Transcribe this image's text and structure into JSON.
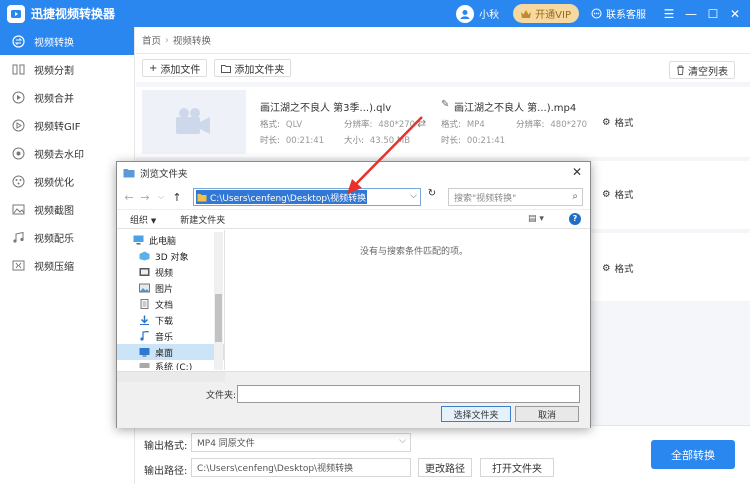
{
  "app": {
    "title": "迅捷视频转换器",
    "username": "小秋",
    "vip_label": "开通VIP",
    "support_label": "联系客服"
  },
  "colors": {
    "brand_blue": "#2b87f0",
    "vip_gold": "#f5d9a0",
    "annotation_red": "#e8312a"
  },
  "sidebar": {
    "items": [
      {
        "label": "视频转换",
        "icon": "convert-icon",
        "active": true
      },
      {
        "label": "视频分割",
        "icon": "split-icon"
      },
      {
        "label": "视频合并",
        "icon": "merge-icon"
      },
      {
        "label": "视频转GIF",
        "icon": "gif-icon"
      },
      {
        "label": "视频去水印",
        "icon": "watermark-icon"
      },
      {
        "label": "视频优化",
        "icon": "optimize-icon"
      },
      {
        "label": "视频截图",
        "icon": "screenshot-icon"
      },
      {
        "label": "视频配乐",
        "icon": "music-icon"
      },
      {
        "label": "视频压缩",
        "icon": "compress-icon"
      }
    ]
  },
  "breadcrumb": {
    "home": "首页",
    "current": "视频转换"
  },
  "toolbar": {
    "add_file": "添加文件",
    "add_folder": "添加文件夹",
    "clear_list": "清空列表"
  },
  "file": {
    "source_name": "画江湖之不良人 第3季...).qlv",
    "target_name": "画江湖之不良人 第...).mp4",
    "src_format_label": "格式:",
    "src_format": "QLV",
    "src_res_label": "分辨率:",
    "src_res": "480*270",
    "src_duration_label": "时长:",
    "src_duration": "00:21:41",
    "src_size_label": "大小:",
    "src_size": "43.50 MB",
    "dst_format_label": "格式:",
    "dst_format": "MP4",
    "dst_res_label": "分辨率:",
    "dst_res": "480*270",
    "dst_duration_label": "时长:",
    "dst_duration": "00:21:41",
    "format_btn": "格式"
  },
  "format_btns": [
    "格式",
    "格式"
  ],
  "bottom": {
    "output_format_label": "输出格式:",
    "output_format_value": "MP4  同原文件",
    "output_path_label": "输出路径:",
    "output_path_value": "C:\\Users\\cenfeng\\Desktop\\视频转换",
    "change_path": "更改路径",
    "open_folder": "打开文件夹",
    "convert_all": "全部转换"
  },
  "dialog": {
    "title": "浏览文件夹",
    "address": "C:\\Users\\cenfeng\\Desktop\\视频转换",
    "search_placeholder": "搜索\"视频转换\"",
    "organize": "组织",
    "new_folder": "新建文件夹",
    "empty_message": "没有与搜索条件匹配的项。",
    "tree": [
      {
        "label": "此电脑",
        "icon": "computer-icon"
      },
      {
        "label": "3D 对象",
        "icon": "3d-objects-icon"
      },
      {
        "label": "视频",
        "icon": "videos-folder-icon"
      },
      {
        "label": "图片",
        "icon": "pictures-folder-icon"
      },
      {
        "label": "文档",
        "icon": "documents-folder-icon"
      },
      {
        "label": "下载",
        "icon": "downloads-folder-icon"
      },
      {
        "label": "音乐",
        "icon": "music-folder-icon"
      },
      {
        "label": "桌面",
        "icon": "desktop-folder-icon",
        "selected": true
      },
      {
        "label": "系统 (C:)",
        "icon": "drive-icon"
      }
    ],
    "folder_label": "文件夹:",
    "folder_value": "",
    "select_btn": "选择文件夹",
    "cancel_btn": "取消"
  }
}
